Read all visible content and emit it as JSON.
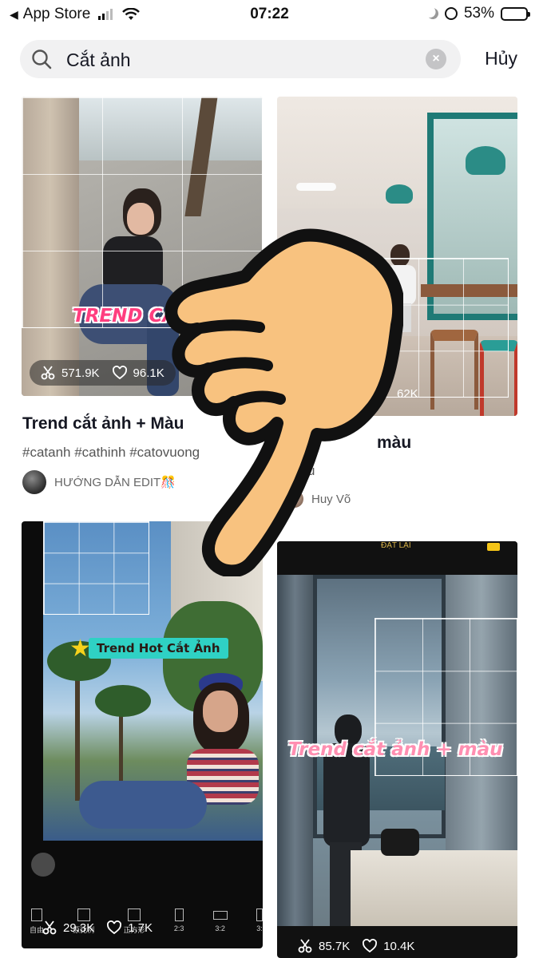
{
  "status_bar": {
    "back_app": "App Store",
    "time": "07:22",
    "battery": "53%",
    "battery_level": 0.53
  },
  "search": {
    "query": "Cắt ảnh",
    "cancel_label": "Hủy"
  },
  "cards": [
    {
      "overlay_text": "TREND CẮT ẢNH",
      "uses": "571.9K",
      "likes": "96.1K",
      "title": "Trend cắt ảnh + Màu",
      "tags": "#catanh #cathinh #catovuong",
      "author": "HƯỚNG DẪN EDIT🎊"
    },
    {
      "uses": "",
      "likes": "62K",
      "title": "màu",
      "tags": "u",
      "author": "Huy Võ"
    },
    {
      "overlay_text": "Trend Hot Cắt Ảnh",
      "uses": "29.3K",
      "likes": "1.7K",
      "ratio_labels": [
        "自由",
        "原比例",
        "正方形",
        "2:3",
        "3:2",
        "3:"
      ]
    },
    {
      "top_label": "ĐẶT LẠI",
      "overlay_text": "Trend cắt ảnh + màu",
      "uses": "85.7K",
      "likes": "10.4K"
    }
  ]
}
